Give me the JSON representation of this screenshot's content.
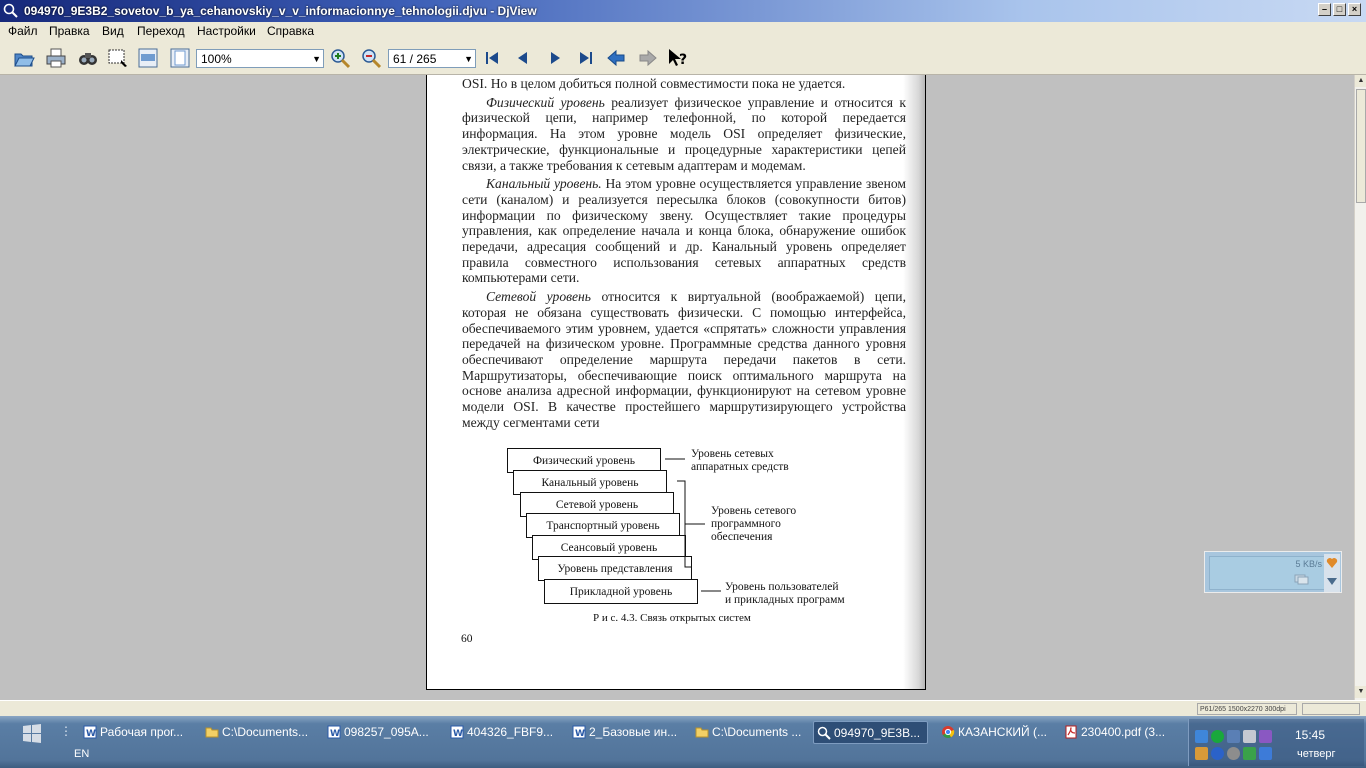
{
  "window": {
    "title": "094970_9E3B2_sovetov_b_ya_cehanovskiy_v_v_informacionnye_tehnologii.djvu - DjView",
    "minimize_glyph": "–",
    "maximize_glyph": "□",
    "close_glyph": "×"
  },
  "menu": [
    "Файл",
    "Правка",
    "Вид",
    "Переход",
    "Настройки",
    "Справка"
  ],
  "toolbar": {
    "zoom_value": "100%",
    "page_value": "61 / 265",
    "icons": [
      "open-icon",
      "print-icon",
      "find-icon",
      "select-icon",
      "fit-width-icon",
      "fit-page-icon",
      "zoom-in-icon",
      "zoom-out-icon",
      "first-page-icon",
      "prev-page-icon",
      "next-page-icon",
      "last-page-icon",
      "back-icon",
      "forward-icon",
      "whats-this-icon"
    ]
  },
  "page": {
    "line0": "OSI. Но в целом добиться полной совместимости пока не удается.",
    "p1_term": "Физический уровень",
    "p1_text": " реализует физическое управление и относится к физической цепи, например телефонной, по которой передается информация. На этом уровне модель OSI определяет физические, электрические, функциональные и процедурные характеристики цепей связи, а также требования к сетевым адаптерам и модемам.",
    "p2_term": "Канальный уровень.",
    "p2_text": " На этом уровне осуществляется управление звеном сети (каналом) и реализуется пересылка блоков (совокупности битов) информации по физическому звену. Осуществляет такие процедуры управления, как определение начала и конца блока, обнаружение ошибок передачи, адресация сообщений и др. Канальный уровень определяет правила совместного использования сетевых аппаратных средств компьютерами сети.",
    "p3_term": "Сетевой уровень",
    "p3_text": " относится к виртуальной (воображаемой) цепи, которая не обязана существовать физически. С помощью интерфейса, обеспечиваемого этим уровнем, удается «спрятать» сложности управления передачей на физическом уровне. Программные средства данного уровня обеспечивают определение маршрута передачи пакетов в сети. Маршрутизаторы, обеспечивающие поиск оптимального маршрута на основе анализа адресной информации, функционируют на сетевом уровне модели OSI. В качестве простейшего маршрутизирующего устройства между сегментами сети",
    "layers": [
      "Физический уровень",
      "Канальный уровень",
      "Сетевой уровень",
      "Транспортный уровень",
      "Сеансовый уровень",
      "Уровень представления",
      "Прикладной уровень"
    ],
    "anno1_l1": "Уровень сетевых",
    "anno1_l2": "аппаратных средств",
    "anno2_l1": "Уровень сетевого",
    "anno2_l2": "программного",
    "anno2_l3": "обеспечения",
    "anno3_l1": "Уровень пользователей",
    "anno3_l2": "и прикладных программ",
    "caption": "Р и с. 4.3. Связь открытых систем",
    "page_number": "60"
  },
  "statusbar": {
    "info": "P61/265 1500x2270 300dpi"
  },
  "netwidget": {
    "speed": "5 KB/s"
  },
  "taskbar": {
    "language": "EN",
    "tasks": [
      {
        "label": "Рабочая прог...",
        "icon": "word-icon"
      },
      {
        "label": "C:\\Documents...",
        "icon": "folder-icon"
      },
      {
        "label": "098257_095A...",
        "icon": "word-icon"
      },
      {
        "label": "404326_FBF9...",
        "icon": "word-icon"
      },
      {
        "label": "2_Базовые ин...",
        "icon": "word-icon"
      },
      {
        "label": "C:\\Documents ...",
        "icon": "folder-icon"
      },
      {
        "label": "094970_9E3B...",
        "icon": "djview-icon"
      },
      {
        "label": "КАЗАНСКИЙ (...",
        "icon": "chrome-icon"
      },
      {
        "label": "230400.pdf (3...",
        "icon": "pdf-icon"
      }
    ],
    "clock": "15:45",
    "day": "четверг"
  },
  "colors": {
    "title_bar": "#3d5fb7",
    "viewer_bg": "#c0c0c0",
    "taskbar": "#52749a"
  }
}
